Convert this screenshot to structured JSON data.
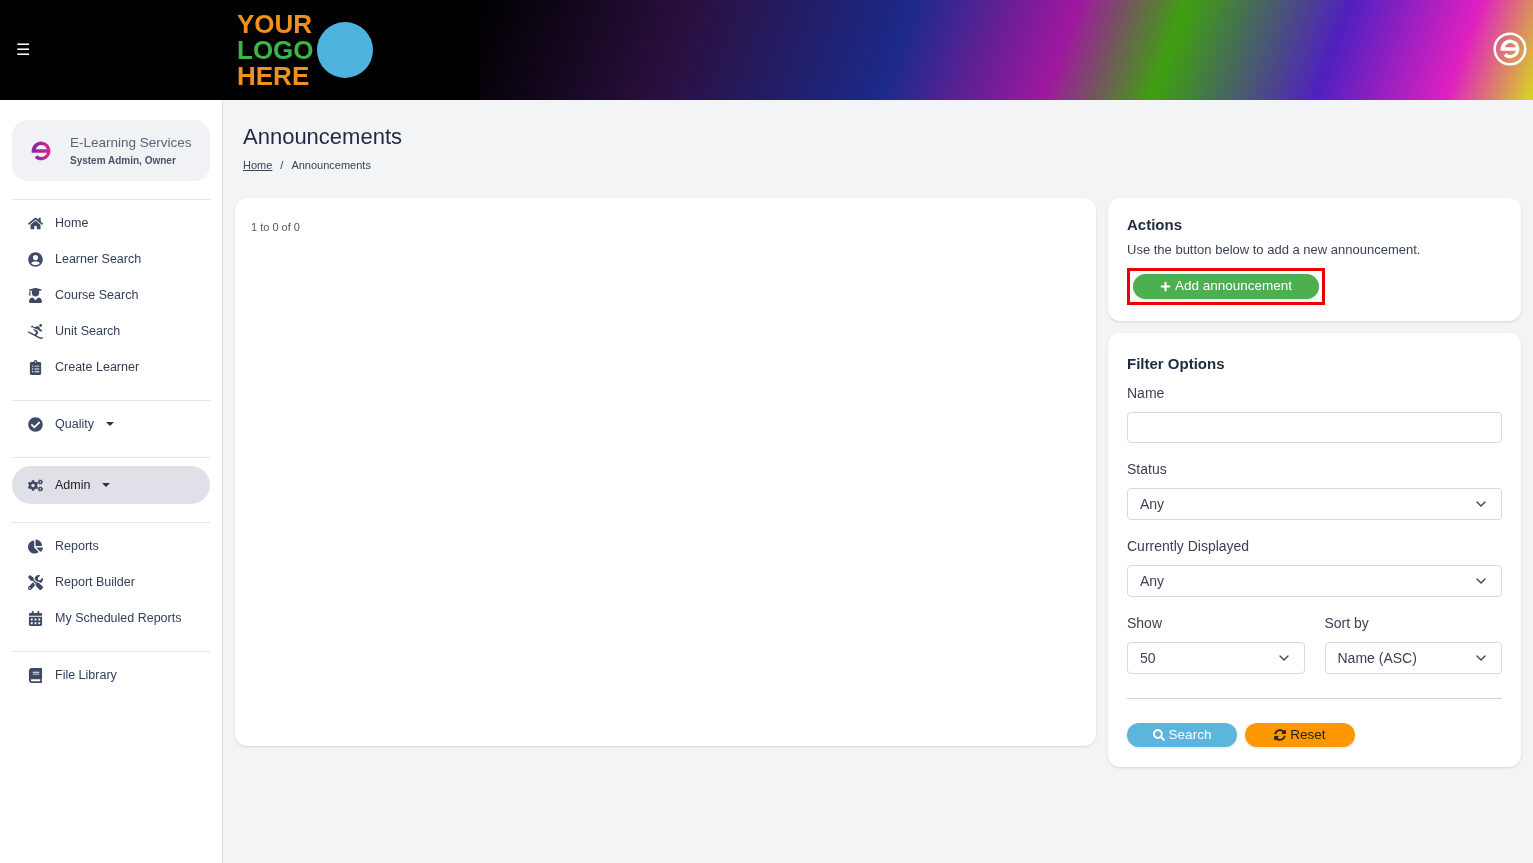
{
  "header": {
    "menu_icon": "☰",
    "logo": [
      "YOUR",
      "LOGO",
      "HERE"
    ]
  },
  "account": {
    "name": "E-Learning Services",
    "role": "System Admin, Owner"
  },
  "sidebar": {
    "groups": [
      [
        {
          "label": "Home",
          "selected": false,
          "dropdown": false
        },
        {
          "label": "Learner Search",
          "selected": false,
          "dropdown": false
        },
        {
          "label": "Course Search",
          "selected": false,
          "dropdown": false
        },
        {
          "label": "Unit Search",
          "selected": false,
          "dropdown": false
        },
        {
          "label": "Create Learner",
          "selected": false,
          "dropdown": false
        }
      ],
      [
        {
          "label": "Quality",
          "selected": false,
          "dropdown": true
        }
      ],
      [
        {
          "label": "Admin",
          "selected": true,
          "dropdown": true
        }
      ],
      [
        {
          "label": "Reports",
          "selected": false,
          "dropdown": false
        },
        {
          "label": "Report Builder",
          "selected": false,
          "dropdown": false
        },
        {
          "label": "My Scheduled Reports",
          "selected": false,
          "dropdown": false
        }
      ],
      [
        {
          "label": "File Library",
          "selected": false,
          "dropdown": false
        }
      ]
    ]
  },
  "page": {
    "title": "Announcements",
    "breadcrumb_separator": "/",
    "breadcrumb": [
      {
        "label": "Home",
        "link": true
      },
      {
        "label": "Announcements",
        "link": false
      }
    ]
  },
  "results": {
    "summary": "1 to 0 of 0"
  },
  "actions": {
    "title": "Actions",
    "text": "Use the button below to add a new announcement.",
    "button": {
      "label": "Add announcement",
      "highlighted": true
    }
  },
  "filters": {
    "title": "Filter Options",
    "fields": [
      {
        "kind": "text",
        "label": "Name"
      },
      {
        "kind": "select",
        "label": "Status",
        "value": "Any"
      },
      {
        "kind": "select",
        "label": "Currently Displayed",
        "value": "Any"
      }
    ],
    "pair": [
      {
        "kind": "select",
        "label": "Show",
        "value": "50"
      },
      {
        "kind": "select",
        "label": "Sort by",
        "value": "Name (ASC)"
      }
    ],
    "buttons": [
      {
        "kind": "search",
        "label": "Search"
      },
      {
        "kind": "reset",
        "label": "Reset"
      }
    ]
  }
}
